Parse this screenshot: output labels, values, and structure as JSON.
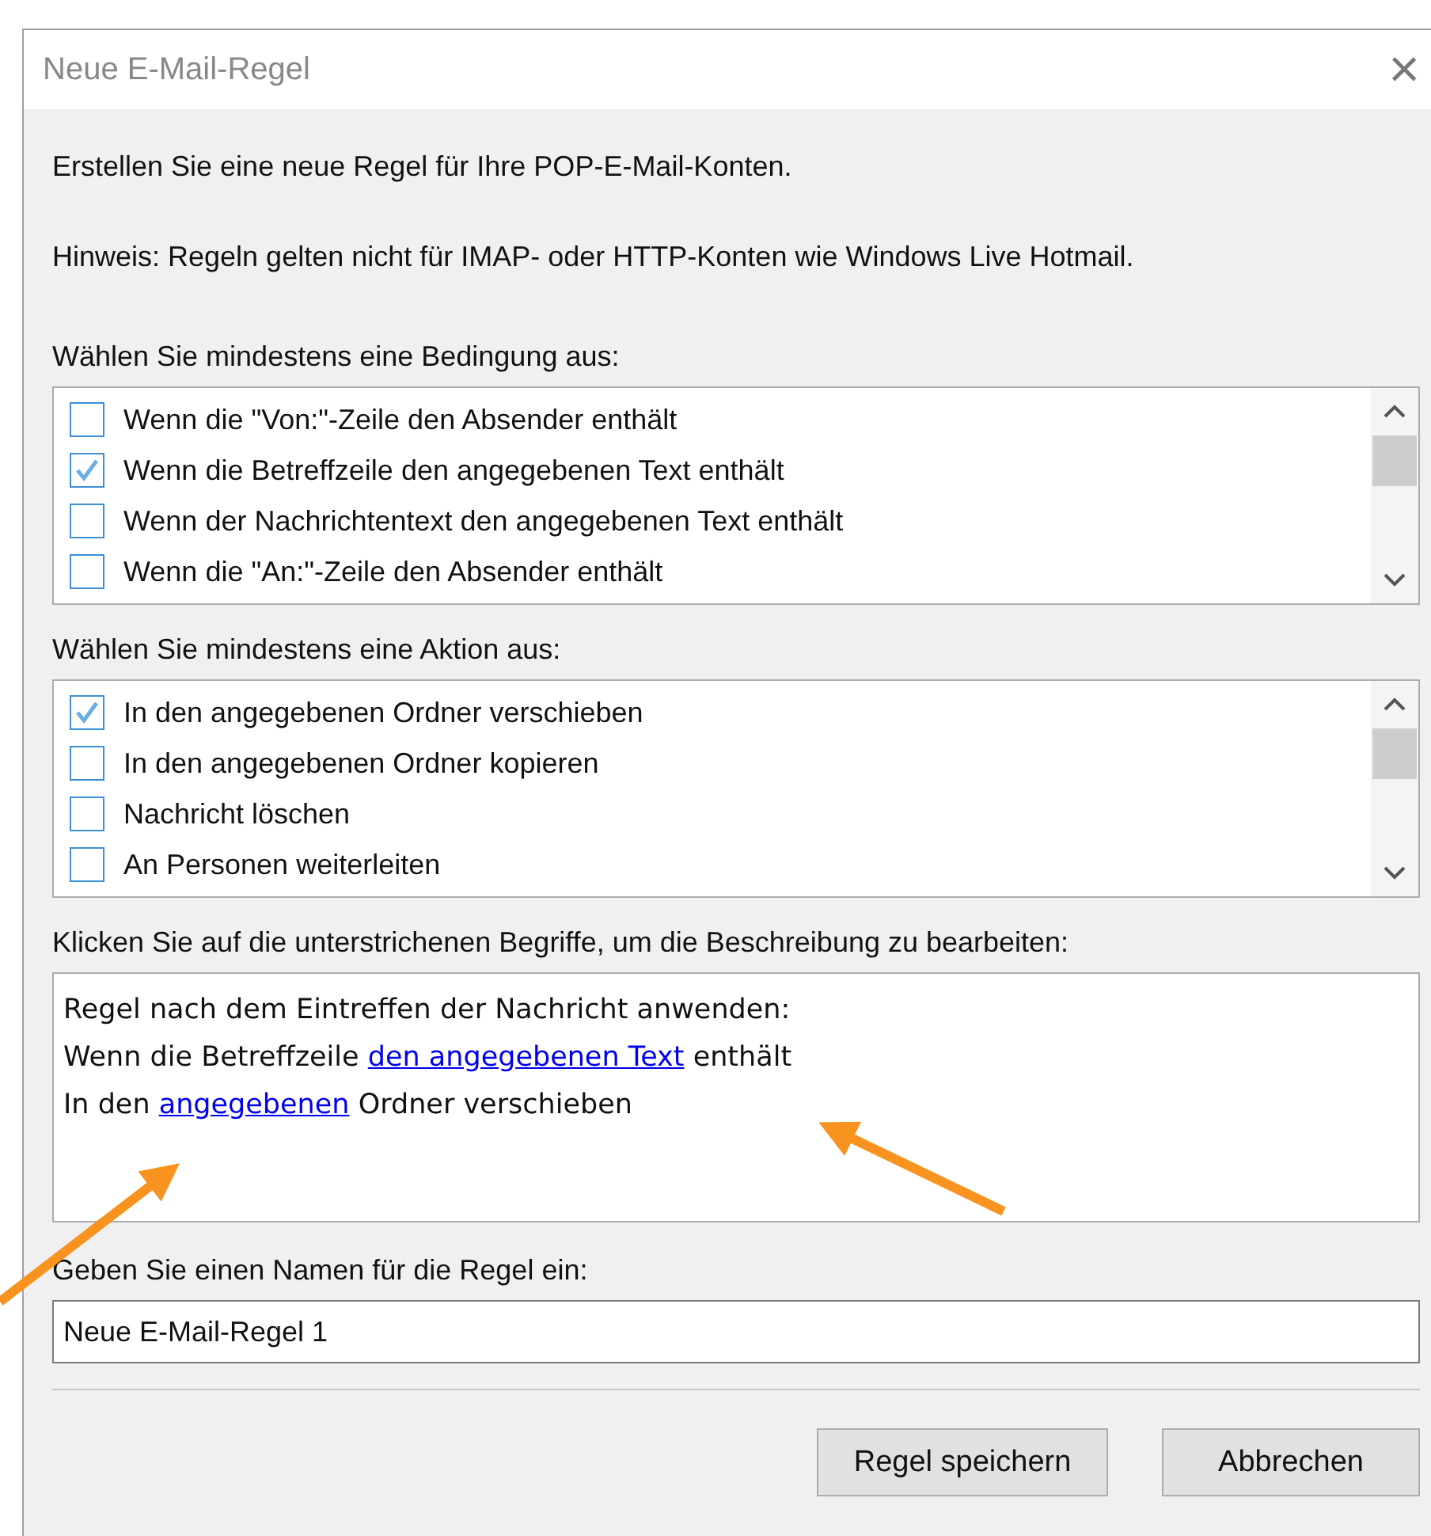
{
  "window": {
    "title": "Neue E-Mail-Regel",
    "close": "×"
  },
  "intro": "Erstellen Sie eine neue Regel für Ihre POP-E-Mail-Konten.",
  "hint": "Hinweis: Regeln gelten nicht für IMAP- oder HTTP-Konten wie Windows Live Hotmail.",
  "conditions": {
    "label": "Wählen Sie mindestens eine Bedingung aus:",
    "items": [
      {
        "label": "Wenn die \"Von:\"-Zeile den Absender enthält",
        "checked": false
      },
      {
        "label": "Wenn die Betreffzeile den angegebenen Text enthält",
        "checked": true
      },
      {
        "label": "Wenn der Nachrichtentext den angegebenen Text enthält",
        "checked": false
      },
      {
        "label": "Wenn die \"An:\"-Zeile den Absender enthält",
        "checked": false
      }
    ]
  },
  "actions": {
    "label": "Wählen Sie mindestens eine Aktion aus:",
    "items": [
      {
        "label": "In den angegebenen Ordner verschieben",
        "checked": true
      },
      {
        "label": "In den angegebenen Ordner kopieren",
        "checked": false
      },
      {
        "label": "Nachricht löschen",
        "checked": false
      },
      {
        "label": "An Personen weiterleiten",
        "checked": false
      }
    ]
  },
  "description": {
    "label": "Klicken Sie auf die unterstrichenen Begriffe, um die Beschreibung zu bearbeiten:",
    "lines": [
      [
        {
          "text": "Regel nach dem Eintreffen der Nachricht anwenden:",
          "link": false
        }
      ],
      [
        {
          "text": "Wenn die Betreffzeile ",
          "link": false
        },
        {
          "text": "den angegebenen Text",
          "link": true
        },
        {
          "text": " enthält",
          "link": false
        }
      ],
      [
        {
          "text": "In den ",
          "link": false
        },
        {
          "text": "angegebenen",
          "link": true
        },
        {
          "text": " Ordner verschieben",
          "link": false
        }
      ]
    ]
  },
  "name": {
    "label": "Geben Sie einen Namen für die Regel ein:",
    "value": "Neue E-Mail-Regel 1"
  },
  "buttons": [
    "Regel speichern",
    "Abbrechen"
  ]
}
